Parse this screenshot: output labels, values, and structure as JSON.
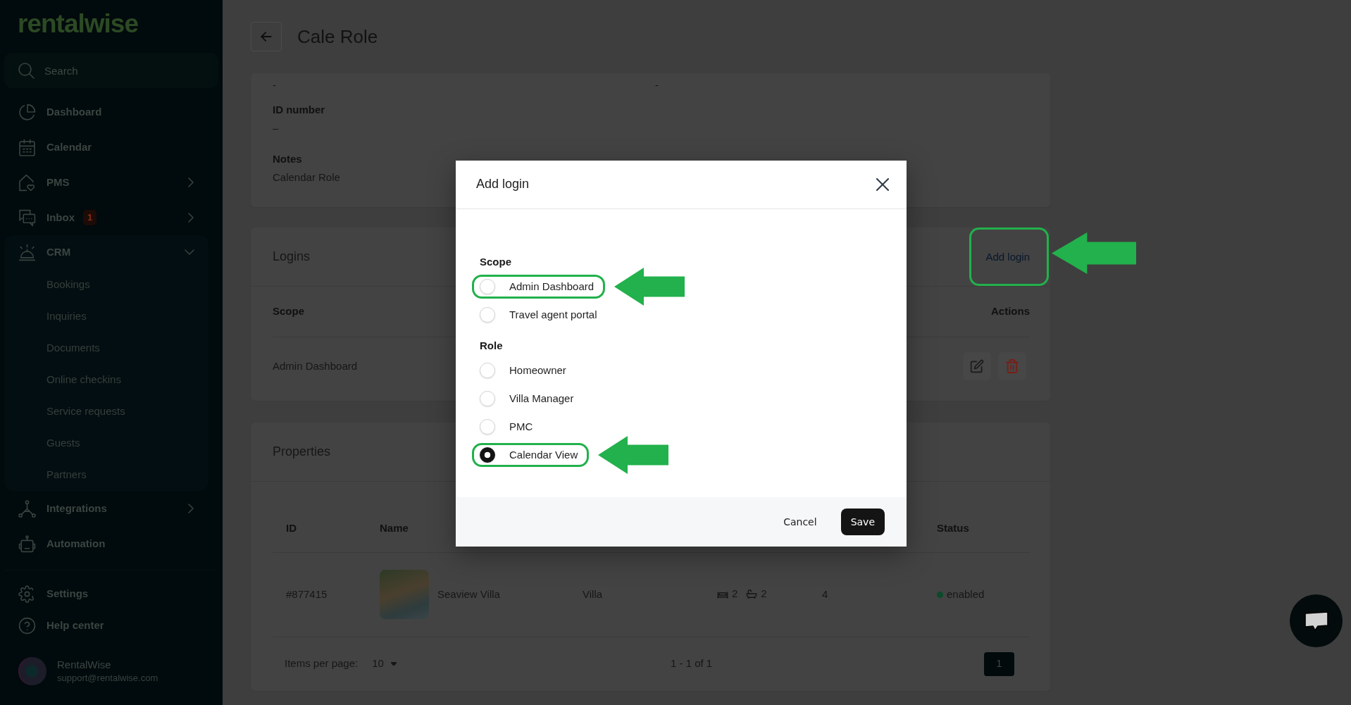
{
  "sidebar": {
    "logo": "rentalwise",
    "search": {
      "placeholder": "Search"
    },
    "items": [
      {
        "label": "Dashboard"
      },
      {
        "label": "Calendar"
      },
      {
        "label": "PMS",
        "expanded": false
      },
      {
        "label": "Inbox",
        "badge": "1",
        "expanded": false
      },
      {
        "label": "CRM",
        "expanded": true,
        "children": [
          {
            "label": "Bookings"
          },
          {
            "label": "Inquiries"
          },
          {
            "label": "Documents"
          },
          {
            "label": "Online checkins"
          },
          {
            "label": "Service requests"
          },
          {
            "label": "Guests"
          },
          {
            "label": "Partners"
          }
        ]
      },
      {
        "label": "Integrations",
        "expanded": false
      },
      {
        "label": "Automation"
      }
    ],
    "footer_items": [
      {
        "label": "Settings"
      },
      {
        "label": "Help center"
      }
    ],
    "user": {
      "name": "RentalWise",
      "email": "support@rentalwise.com"
    }
  },
  "page": {
    "title": "Cale Role",
    "details": [
      [
        {
          "value": "-"
        },
        {
          "value": "-"
        }
      ],
      [
        {
          "label": "ID number",
          "value": "–"
        }
      ],
      [
        {
          "label": "Notes",
          "value": "Calendar Role"
        }
      ]
    ],
    "logins": {
      "title": "Logins",
      "add_button": {
        "label": "Add login",
        "highlighted": true
      },
      "columns": [
        "Scope",
        "Actions"
      ],
      "rows": [
        {
          "scope": "Admin Dashboard"
        }
      ]
    },
    "properties": {
      "title": "Properties",
      "columns": [
        "ID",
        "Name",
        null,
        null,
        null,
        "Status"
      ],
      "rows": [
        {
          "id": "#877415",
          "name": "Seaview Villa",
          "column_3": "Villa",
          "bedrooms": "2",
          "bathrooms": "2",
          "column_5": "4",
          "status": {
            "label": "enabled",
            "color": "#0b4a2b"
          }
        }
      ],
      "pagination": {
        "items_per_page_label": "Items per page:",
        "items_per_page": "10",
        "range": "1 - 1 of 1",
        "pages": [
          {
            "label": "1",
            "selected": true
          }
        ]
      }
    }
  },
  "modal": {
    "title": "Add login",
    "groups": [
      {
        "label": "Scope",
        "options": [
          {
            "label": "Admin Dashboard",
            "selected": false,
            "highlighted": true
          },
          {
            "label": "Travel agent portal",
            "selected": false,
            "highlighted": false
          }
        ]
      },
      {
        "label": "Role",
        "options": [
          {
            "label": "Homeowner",
            "selected": false,
            "highlighted": false
          },
          {
            "label": "Villa Manager",
            "selected": false,
            "highlighted": false
          },
          {
            "label": "PMC",
            "selected": false,
            "highlighted": false
          },
          {
            "label": "Calendar View",
            "selected": true,
            "highlighted": true
          }
        ]
      }
    ],
    "buttons": [
      {
        "label": "Cancel",
        "kind": "secondary"
      },
      {
        "label": "Save",
        "kind": "primary"
      }
    ]
  }
}
